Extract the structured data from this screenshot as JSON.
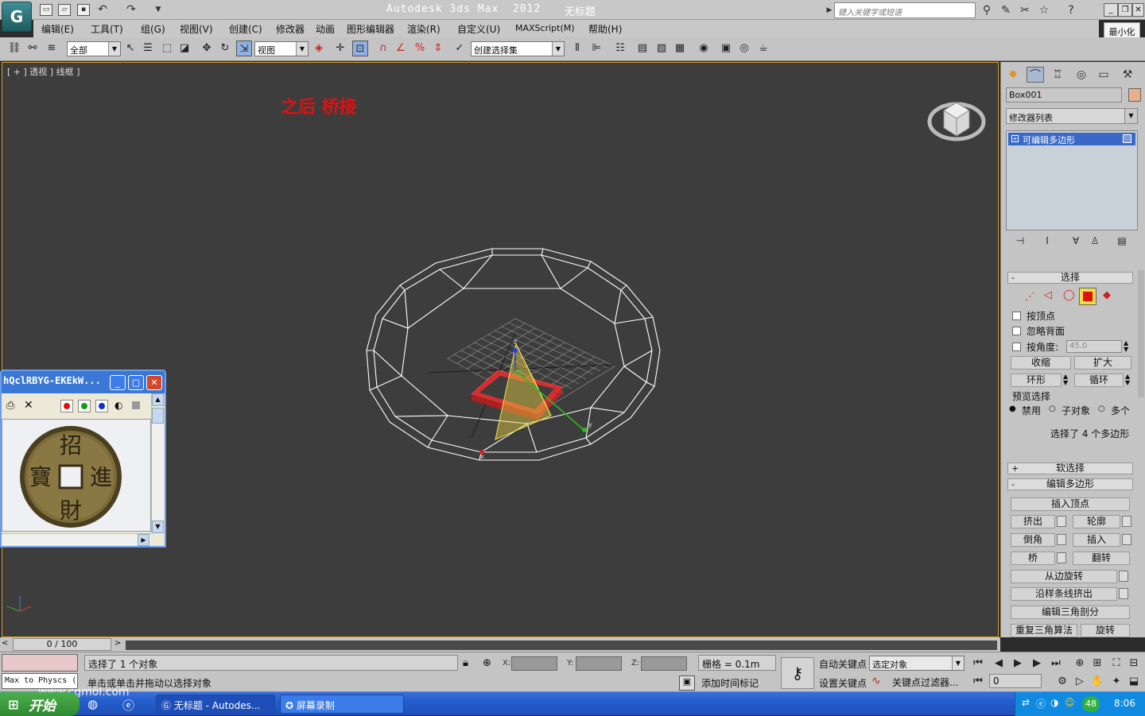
{
  "titlebar": {
    "app_title": "Autodesk 3ds Max  2012",
    "doc_title": "无标题",
    "search_placeholder": "键入关键字或短语",
    "minimize_tip": "最小化",
    "logo_glyph": "G"
  },
  "menu": [
    "编辑(E)",
    "工具(T)",
    "组(G)",
    "视图(V)",
    "创建(C)",
    "修改器",
    "动画",
    "图形编辑器",
    "渲染(R)",
    "自定义(U)",
    "MAXScript(M)",
    "帮助(H)"
  ],
  "toolbar": {
    "filter_value": "全部",
    "refcoord_value": "视图",
    "selection_set_value": "创建选择集"
  },
  "viewport": {
    "label": "[ + ] 透视 ] 线框 ]",
    "annotation": "之后 桥接",
    "axis_x": "x",
    "axis_y": "y",
    "axis_z": "z",
    "border_color": "#d8a020"
  },
  "command_panel": {
    "object_name": "Box001",
    "object_color": "#e8b08a",
    "modifier_list": "修改器列表",
    "stack_item": "可编辑多边形",
    "selection_rollout": "选择",
    "by_vertex": "按顶点",
    "ignore_backfacing": "忽略背面",
    "by_angle": "按角度:",
    "angle_value": "45.0",
    "shrink": "收缩",
    "grow": "扩大",
    "ring": "环形",
    "loop": "循环",
    "preview_selection": "预览选择",
    "preview_options": [
      "禁用",
      "子对象",
      "多个"
    ],
    "selection_status": "选择了 4 个多边形",
    "soft_selection": "软选择",
    "edit_polygons": "编辑多边形",
    "insert_vertex": "插入顶点",
    "extrude": "挤出",
    "outline": "轮廓",
    "bevel": "倒角",
    "inset": "插入",
    "bridge": "桥",
    "flip": "翻转",
    "hinge_from_edge": "从边旋转",
    "extrude_along_spline": "沿样条线挤出",
    "edit_triangulation": "编辑三角剖分",
    "retriangulate": "重复三角算法",
    "turn": "旋转"
  },
  "timeslider": {
    "value": "0 / 100"
  },
  "status": {
    "maxscript_listener": "Max to Physcs (",
    "selected_text": "选择了 1 个对象",
    "prompt_text": "单击或单击并拖动以选择对象",
    "x_label": "X:",
    "y_label": "Y:",
    "z_label": "Z:",
    "grid": "栅格 = 0.1m",
    "add_time_tag": "添加时间标记",
    "auto_key": "自动关键点",
    "set_key": "设置关键点",
    "selected_object": "选定对象",
    "key_filters": "关键点过滤器...",
    "frame_value": "0"
  },
  "floating_window": {
    "title": "hQclRBYG-EKEkW...",
    "coin_chars": [
      "招",
      "進",
      "財",
      "寶"
    ],
    "dot_colors": [
      "#e01010",
      "#10a010",
      "#1030d0"
    ]
  },
  "taskbar": {
    "start": "开始",
    "watermark": "www.cgmol.com",
    "tasks": [
      "无标题 - Autodes...",
      "屏幕录制"
    ],
    "tray_badge": "48",
    "clock": "8:06"
  }
}
